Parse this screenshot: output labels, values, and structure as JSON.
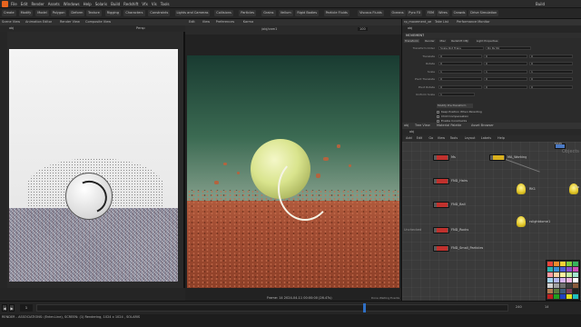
{
  "menu": [
    "File",
    "Edit",
    "Render",
    "Assets",
    "Windows",
    "Help",
    "Solaris",
    "Build",
    "Redshift",
    "Vfx",
    "Vis",
    "Tools"
  ],
  "desktop": "Build",
  "shelf_tabs": [
    "Create",
    "Modify",
    "Model",
    "Polygon",
    "Deform",
    "Texture",
    "Rigging",
    "Characters",
    "Constraints",
    "Lights and Cameras",
    "Collisions",
    "Particles",
    "Grains",
    "Vellum",
    "Rigid Bodies",
    "Particle Fluids",
    "Viscous Fluids",
    "Oceans",
    "Pyro FX",
    "FEM",
    "Wires",
    "Crowds",
    "Drive Simulation"
  ],
  "left_pane": {
    "tabs": [
      "Scene View",
      "Animation Editor",
      "Render View",
      "Composite View"
    ],
    "path": "obj",
    "camera": "Persp",
    "frame": "1"
  },
  "render_view": {
    "menu": [
      "Edit",
      "View",
      "Preferences",
      "Karma"
    ],
    "camera": "/obj/cam1",
    "zoom": "100",
    "status": "Frame: 14  2024-04-11  00:00:00  (26.47s)",
    "status_right": "Done   Waiting Events"
  },
  "params": {
    "tabs": [
      "rp_movement_xe",
      "Take List",
      "Performance Monitor"
    ],
    "node_path": "obj",
    "node_name": "MOVEMENT",
    "sub_tabs": [
      "Transform",
      "Render",
      "Misc",
      "Redshift OBJ",
      "Light Properties"
    ],
    "rows": [
      {
        "label": "Transform Order",
        "values": [
          "Scale Rot Trans",
          "Rx Ry Rz"
        ]
      },
      {
        "label": "Translate",
        "values": [
          "0",
          "0",
          "0"
        ]
      },
      {
        "label": "Rotate",
        "values": [
          "0",
          "0",
          "0"
        ]
      },
      {
        "label": "Scale",
        "values": [
          "1",
          "1",
          "1"
        ]
      },
      {
        "label": "Pivot Translate",
        "values": [
          "0",
          "0",
          "0"
        ]
      },
      {
        "label": "Pivot Rotate",
        "values": [
          "0",
          "0",
          "0"
        ]
      },
      {
        "label": "Uniform Scale",
        "values": [
          "1"
        ]
      }
    ],
    "modify_button": "Modify Pre-Transform",
    "checkboxes": [
      "Keep Position When Parenting",
      "Child Compensation",
      "Enable Constraints"
    ]
  },
  "network": {
    "tabs": [
      "obj",
      "Tree View",
      "Material Palette",
      "Asset Browser"
    ],
    "path": "obj",
    "menu": [
      "Add",
      "Edit",
      "Go",
      "View",
      "Tools",
      "Layout",
      "Labels",
      "Help"
    ],
    "label_objects": "Objects",
    "side_label": "Unchecked",
    "nodes": [
      {
        "label": "Ms",
        "color": "red"
      },
      {
        "label": "MA_Working",
        "color": "yellow"
      },
      {
        "label": "FND_Hairs",
        "color": "red"
      },
      {
        "label": "FND_Ball",
        "color": "red"
      },
      {
        "label": "FND_Rocks",
        "color": "red"
      },
      {
        "label": "FND_Small_Particles",
        "color": "red"
      },
      {
        "label": "MAIN",
        "color": "blue"
      }
    ],
    "lights": [
      "RK1",
      "rslightdome1",
      "Fro"
    ],
    "palette": [
      "#e8453c",
      "#f08b2c",
      "#f6d235",
      "#7fd03c",
      "#36b35c",
      "#2bb5b0",
      "#3a8fd6",
      "#4d5fd9",
      "#8b4fd0",
      "#d04fb8",
      "#ff9aa2",
      "#ffd1a4",
      "#fff3a0",
      "#c5f0a4",
      "#a4e6d0",
      "#a4d2f0",
      "#b4b8f0",
      "#d6b4f0",
      "#f0b4e2",
      "#ffffff",
      "#d0d0d0",
      "#a0a0a0",
      "#707070",
      "#404040",
      "#8a5a3c",
      "#b07a50",
      "#5a7a3c",
      "#3c5a7a",
      "#7a3c5a",
      "#202020",
      "#c02020",
      "#20a020",
      "#2040c0",
      "#e0e020",
      "#20c0c0"
    ]
  },
  "playbar": {
    "frame": "1",
    "end": "240",
    "current": "14"
  },
  "status": "RENDER - ASSOCIATIONS: (Enter-Line), SCREEN: (1) Rendering, 1024 x 1024 , SOLARIS"
}
